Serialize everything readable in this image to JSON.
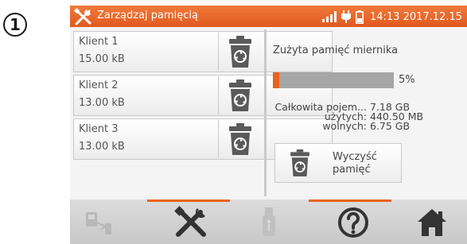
{
  "step_label": "1",
  "titlebar": {
    "title": "Zarządzaj pamięcią",
    "time": "14:13 2017.12.15",
    "icon": "wrench-screwdriver-icon"
  },
  "clients": [
    {
      "name": "Klient 1",
      "size": "15.00 kB"
    },
    {
      "name": "Klient 2",
      "size": "13.00 kB"
    },
    {
      "name": "Klient 3",
      "size": "13.00 kB"
    }
  ],
  "memory": {
    "title": "Zużyta pamięć miernika",
    "used_percent": 5,
    "used_percent_label": "5%",
    "total_label": "Całkowita pojem...",
    "total_value": "7.18 GB",
    "used_label": "użytych:",
    "used_value": "440.50 MB",
    "free_label": "wolnych:",
    "free_value": "6.75 GB"
  },
  "clear_button": {
    "line1": "Wyczyść",
    "line2": "pamięć"
  },
  "toolbar": {
    "items": [
      "data-transfer-icon",
      "wrench-screwdriver-icon",
      "usb-icon",
      "help-icon",
      "home-icon"
    ]
  },
  "colors": {
    "accent": "#e8641c",
    "panel": "#f4f4f4",
    "toolbar": "#d2d2d2"
  }
}
